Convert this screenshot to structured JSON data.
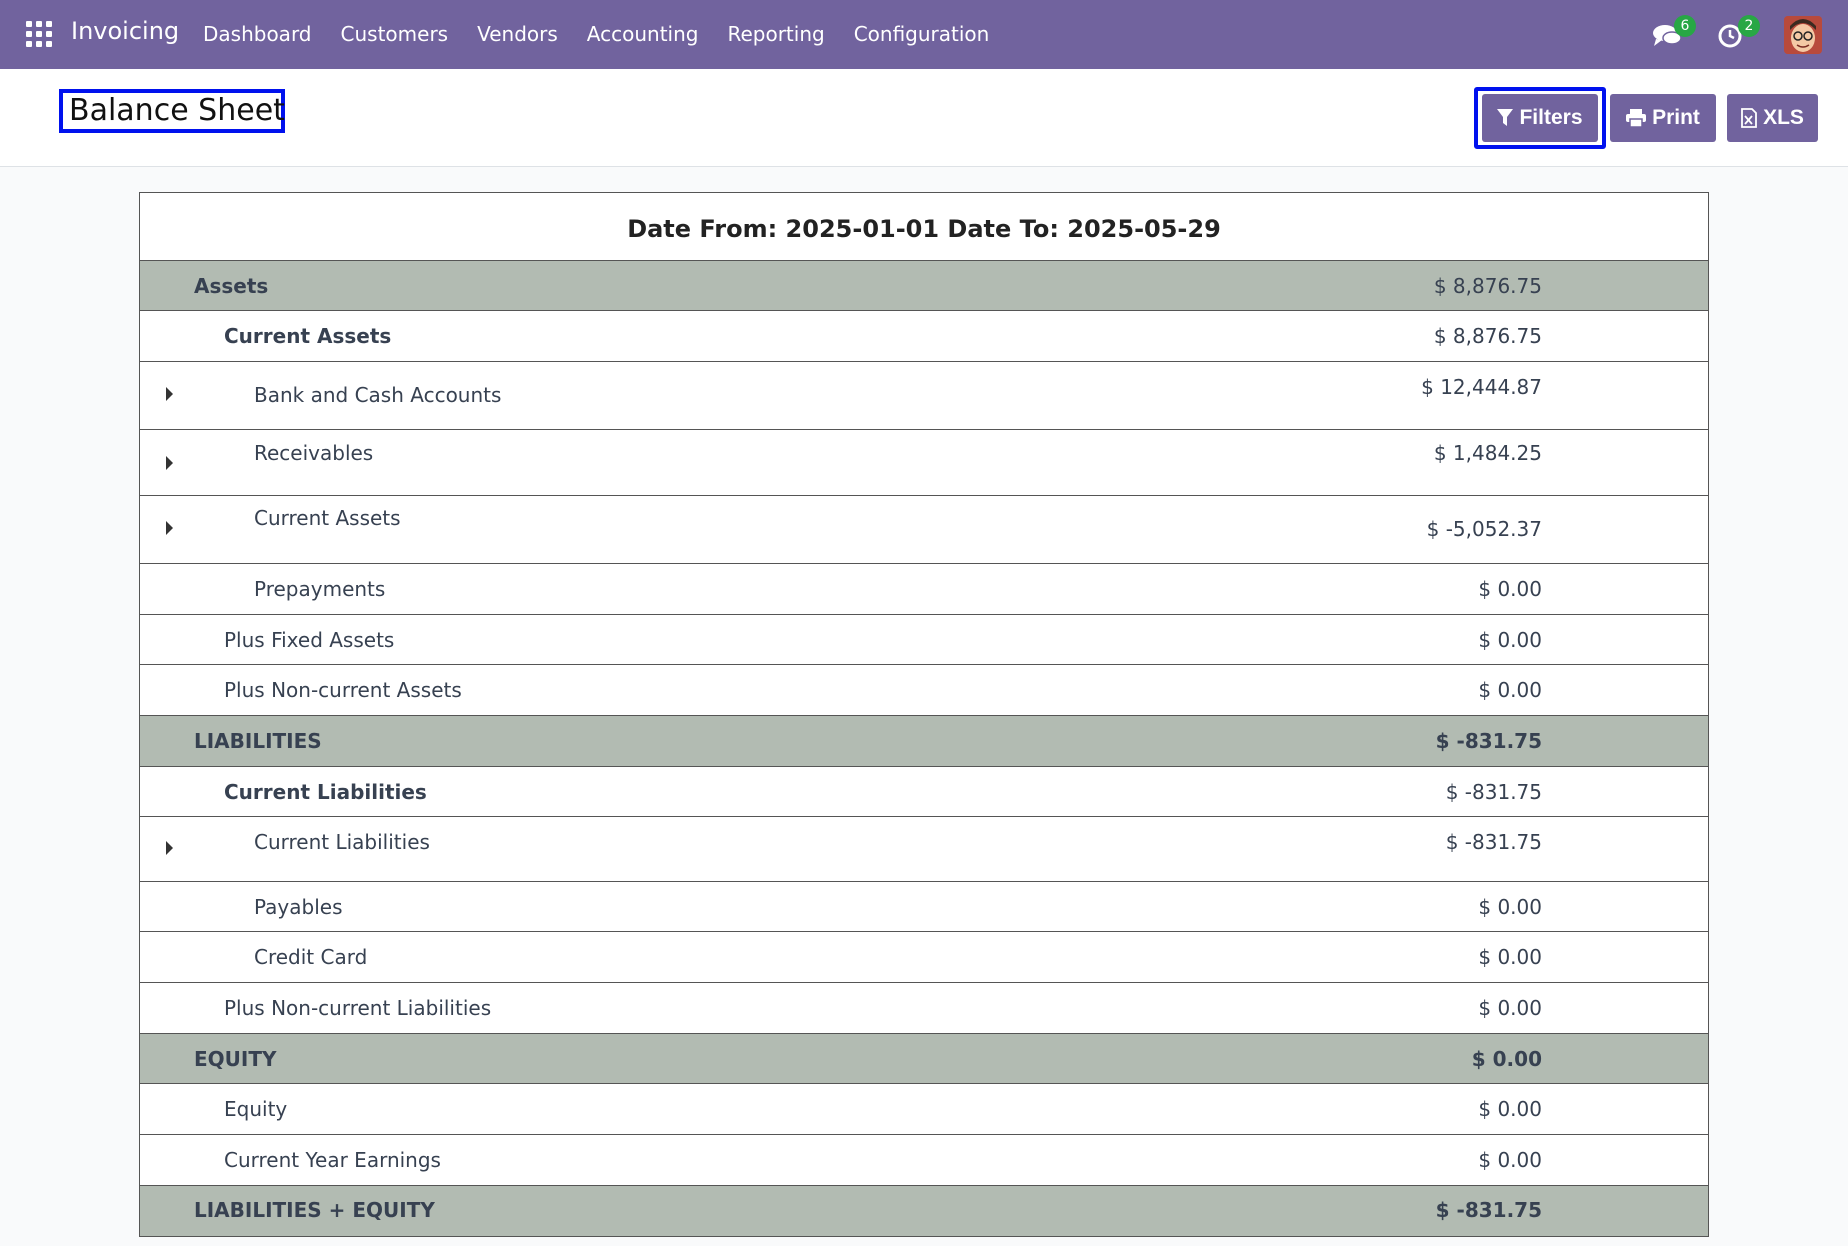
{
  "app": {
    "name": "Invoicing"
  },
  "nav": {
    "items": [
      "Dashboard",
      "Customers",
      "Vendors",
      "Accounting",
      "Reporting",
      "Configuration"
    ]
  },
  "systray": {
    "messages_count": "6",
    "activities_count": "2"
  },
  "page": {
    "title": "Balance Sheet"
  },
  "toolbar": {
    "filters_label": "Filters",
    "print_label": "Print",
    "xls_label": "XLS"
  },
  "report": {
    "header": "Date From: 2025-01-01 Date To: 2025-05-29",
    "rows": [
      {
        "label": "Assets",
        "amount": "$ 8,876.75"
      },
      {
        "label": "Current Assets",
        "amount": "$ 8,876.75"
      },
      {
        "label": "Bank and Cash Accounts",
        "amount": "$ 12,444.87"
      },
      {
        "label": "Receivables",
        "amount": "$ 1,484.25"
      },
      {
        "label": "Current Assets",
        "amount": "$ -5,052.37"
      },
      {
        "label": "Prepayments",
        "amount": "$ 0.00"
      },
      {
        "label": "Plus Fixed Assets",
        "amount": "$ 0.00"
      },
      {
        "label": "Plus Non-current Assets",
        "amount": "$ 0.00"
      },
      {
        "label": "LIABILITIES",
        "amount": "$ -831.75"
      },
      {
        "label": "Current Liabilities",
        "amount": "$ -831.75"
      },
      {
        "label": "Current Liabilities",
        "amount": "$ -831.75"
      },
      {
        "label": "Payables",
        "amount": "$ 0.00"
      },
      {
        "label": "Credit Card",
        "amount": "$ 0.00"
      },
      {
        "label": "Plus Non-current Liabilities",
        "amount": "$ 0.00"
      },
      {
        "label": "EQUITY",
        "amount": "$ 0.00"
      },
      {
        "label": "Equity",
        "amount": "$ 0.00"
      },
      {
        "label": "Current Year Earnings",
        "amount": "$ 0.00"
      },
      {
        "label": "LIABILITIES + EQUITY",
        "amount": "$ -831.75"
      }
    ]
  }
}
